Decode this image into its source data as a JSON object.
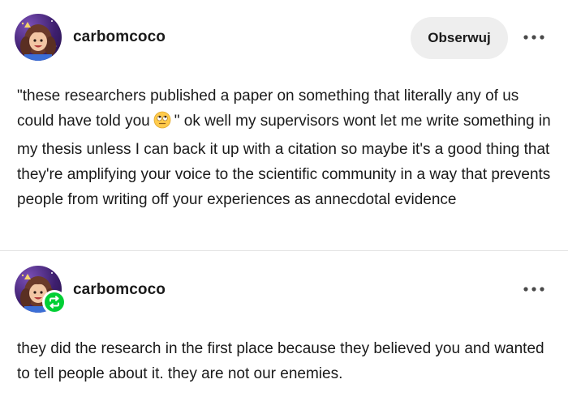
{
  "posts": [
    {
      "username": "carbomcoco",
      "follow_label": "Obserwuj",
      "more_icon": "ellipsis-icon",
      "text_before_emoji": "\"these researchers published a paper on something that literally any of us could have told you",
      "emoji": "face-with-rolling-eyes-icon",
      "text_after_emoji": "\" ok well my supervisors wont let me write something in my thesis unless I can back it up with a citation so maybe it's a good thing that they're amplifying your voice to the scientific community in a way that prevents people from writing off your experiences as annecdotal evidence"
    },
    {
      "username": "carbomcoco",
      "badge_icon": "reblog-icon",
      "more_icon": "ellipsis-icon",
      "text": "they did the research in the first place because they believed you and wanted to tell people about it. they are not our enemies."
    }
  ],
  "colors": {
    "follow_bg": "#eeeeee",
    "reblog_green": "#00cf35",
    "divider": "#e2e2e2",
    "text": "#1a1a1a"
  }
}
